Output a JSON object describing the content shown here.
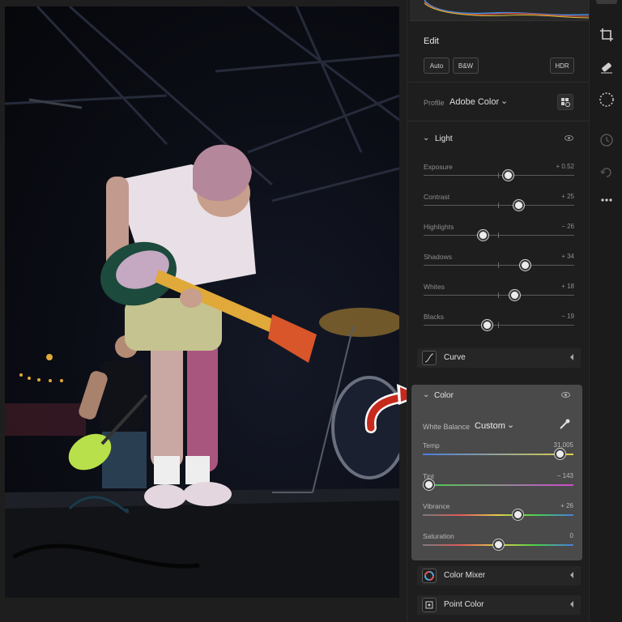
{
  "edit": {
    "title": "Edit",
    "auto_label": "Auto",
    "bw_label": "B&W",
    "hdr_label": "HDR"
  },
  "profile": {
    "label": "Profile",
    "value": "Adobe Color"
  },
  "light": {
    "title": "Light",
    "sliders": [
      {
        "label": "Exposure",
        "value": "+ 0.52",
        "level": 0.56
      },
      {
        "label": "Contrast",
        "value": "+ 25",
        "level": 0.63
      },
      {
        "label": "Highlights",
        "value": "− 26",
        "level": 0.39
      },
      {
        "label": "Shadows",
        "value": "+ 34",
        "level": 0.67
      },
      {
        "label": "Whites",
        "value": "+ 18",
        "level": 0.6
      },
      {
        "label": "Blacks",
        "value": "− 19",
        "level": 0.42
      }
    ]
  },
  "curve": {
    "label": "Curve"
  },
  "color": {
    "title": "Color",
    "white_balance_label": "White Balance",
    "white_balance_value": "Custom",
    "sliders": [
      {
        "label": "Temp",
        "value": "31,005",
        "level": 0.91
      },
      {
        "label": "Tint",
        "value": "− 143",
        "level": 0.04
      },
      {
        "label": "Vibrance",
        "value": "+ 26",
        "level": 0.63
      },
      {
        "label": "Saturation",
        "value": "0",
        "level": 0.5
      }
    ]
  },
  "color_mixer": {
    "label": "Color Mixer"
  },
  "point_color": {
    "label": "Point Color"
  },
  "colors": {
    "panel_bg": "#1e1e1e",
    "color_section_bg": "#4a4a4a",
    "annotation_arrow": "#c62a1c"
  },
  "toolbar": {
    "icons": [
      "crop-icon",
      "healing-icon",
      "masking-icon",
      "history-icon",
      "versions-icon",
      "more-icon"
    ]
  }
}
